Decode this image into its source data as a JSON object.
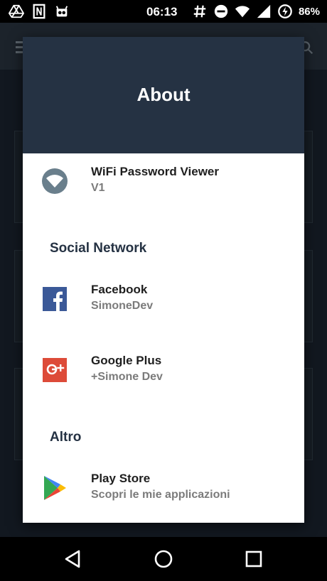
{
  "status_bar": {
    "time": "06:13",
    "battery_percent": "86%",
    "left_icons": [
      "drive-icon",
      "nfc-icon",
      "cyanogen-icon"
    ],
    "right_icons": [
      "hashtag-icon",
      "dnd-icon",
      "wifi-icon",
      "cell-signal-icon",
      "battery-charging-icon"
    ]
  },
  "dialog": {
    "title": "About",
    "app": {
      "name": "WiFi Password Viewer",
      "version": "V1"
    },
    "sections": [
      {
        "heading": "Social Network",
        "items": [
          {
            "title": "Facebook",
            "subtitle": "SimoneDev",
            "icon": "facebook-icon"
          },
          {
            "title": "Google Plus",
            "subtitle": "+Simone Dev",
            "icon": "google-plus-icon"
          }
        ]
      },
      {
        "heading": "Altro",
        "items": [
          {
            "title": "Play Store",
            "subtitle": "Scopri le mie applicazioni",
            "icon": "play-store-icon"
          }
        ]
      }
    ]
  },
  "colors": {
    "header": "#253243",
    "facebook": "#3b5998",
    "google_plus": "#dd4b39",
    "section_heading": "#253243"
  }
}
